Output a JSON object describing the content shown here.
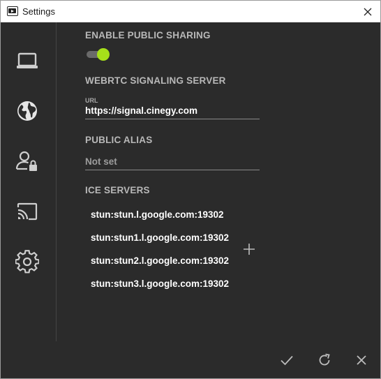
{
  "window": {
    "title": "Settings"
  },
  "sidebar": {
    "items": [
      {
        "name": "display",
        "icon": "laptop-icon"
      },
      {
        "name": "network",
        "icon": "globe-icon"
      },
      {
        "name": "user-security",
        "icon": "user-lock-icon"
      },
      {
        "name": "cast",
        "icon": "cast-icon"
      },
      {
        "name": "settings",
        "icon": "gear-icon"
      }
    ]
  },
  "sharing": {
    "title": "ENABLE PUBLIC SHARING",
    "enabled": true
  },
  "signaling": {
    "title": "WEBRTC SIGNALING SERVER",
    "url_label": "URL",
    "url_value": "https://signal.cinegy.com"
  },
  "alias": {
    "title": "PUBLIC ALIAS",
    "placeholder": "Not set"
  },
  "ice": {
    "title": "ICE SERVERS",
    "servers": [
      "stun:stun.l.google.com:19302",
      "stun:stun1.l.google.com:19302",
      "stun:stun2.l.google.com:19302",
      "stun:stun3.l.google.com:19302"
    ],
    "add_icon": "plus-icon"
  },
  "footer": {
    "apply_icon": "check-icon",
    "reset_icon": "refresh-icon",
    "cancel_icon": "close-icon"
  },
  "colors": {
    "background": "#2b2b2b",
    "accent": "#a6e01a",
    "section_title": "#b8b8b8",
    "icon": "#cfcfcf"
  }
}
